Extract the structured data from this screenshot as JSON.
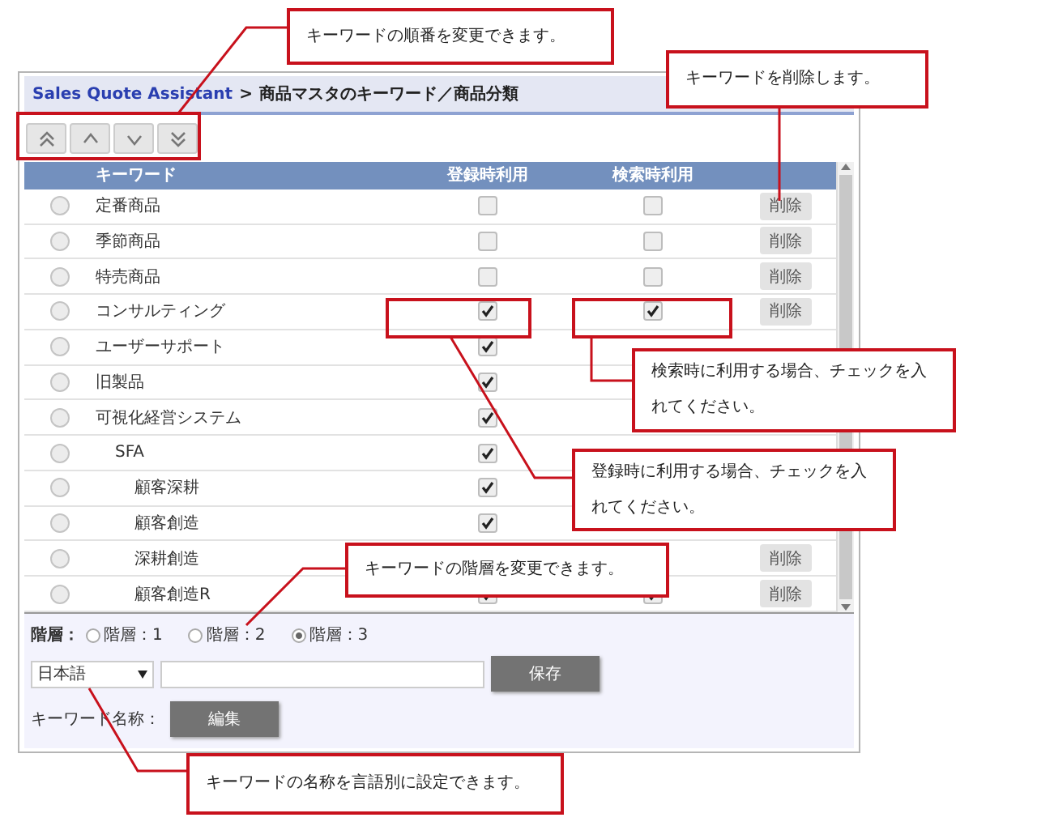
{
  "breadcrumb": {
    "link": "Sales Quote Assistant",
    "separator": ">",
    "title": "商品マスタのキーワード／商品分類"
  },
  "order_buttons": [
    {
      "kind": "top"
    },
    {
      "kind": "up"
    },
    {
      "kind": "down"
    },
    {
      "kind": "bottom"
    }
  ],
  "table": {
    "columns": [
      "キーワード",
      "登録時利用",
      "検索時利用"
    ],
    "rows": [
      {
        "label": "定番商品",
        "selected": false,
        "registration": {
          "checked": false
        },
        "search": {
          "checked": false
        },
        "delete": "削除"
      },
      {
        "label": "季節商品",
        "selected": false,
        "registration": {
          "checked": false
        },
        "search": {
          "checked": false
        },
        "delete": "削除"
      },
      {
        "label": "特売商品",
        "selected": false,
        "registration": {
          "checked": false
        },
        "search": {
          "checked": false
        },
        "delete": "削除"
      },
      {
        "label": "コンサルティング",
        "selected": false,
        "registration": {
          "checked": true
        },
        "search": {
          "checked": true
        },
        "delete": "削除"
      },
      {
        "label": "ユーザーサポート",
        "selected": false,
        "registration": {
          "checked": true
        }
      },
      {
        "label": "旧製品",
        "selected": false,
        "registration": {
          "checked": true
        }
      },
      {
        "label": "可視化経営システム",
        "selected": false,
        "registration": {
          "checked": true
        },
        "children": [
          {
            "label": "SFA",
            "selected": false,
            "registration": {
              "checked": true
            },
            "children": [
              {
                "label": "顧客深耕",
                "selected": false,
                "registration": {
                  "checked": true
                }
              },
              {
                "label": "顧客創造",
                "selected": false,
                "registration": {
                  "checked": true
                }
              },
              {
                "label": "深耕創造",
                "selected": false,
                "delete": "削除"
              },
              {
                "label": "顧客創造R",
                "selected": false,
                "registration": {
                  "checked": true
                },
                "search": {
                  "checked": true
                },
                "delete": "削除"
              }
            ]
          }
        ]
      }
    ]
  },
  "levels": {
    "label": "階層：",
    "options": [
      {
        "label": "階層：1",
        "selected": false
      },
      {
        "label": "階層：2",
        "selected": false
      },
      {
        "label": "階層：3",
        "selected": true
      }
    ]
  },
  "language_select": {
    "value": "日本語"
  },
  "save_button": "保存",
  "name_label": "キーワード名称：",
  "edit_button": "編集",
  "annotations": [
    {
      "kind": "order",
      "text": "キーワードの順番を変更できます。"
    },
    {
      "kind": "delete",
      "text": "キーワードを削除します。"
    },
    {
      "kind": "search",
      "text": "検索時に利用する場合、チェックを入れてください。"
    },
    {
      "kind": "registration",
      "text": "登録時に利用する場合、チェックを入れてください。"
    },
    {
      "kind": "level",
      "text": "キーワードの階層を変更できます。"
    },
    {
      "kind": "language",
      "text": "キーワードの名称を言語別に設定できます。"
    }
  ]
}
